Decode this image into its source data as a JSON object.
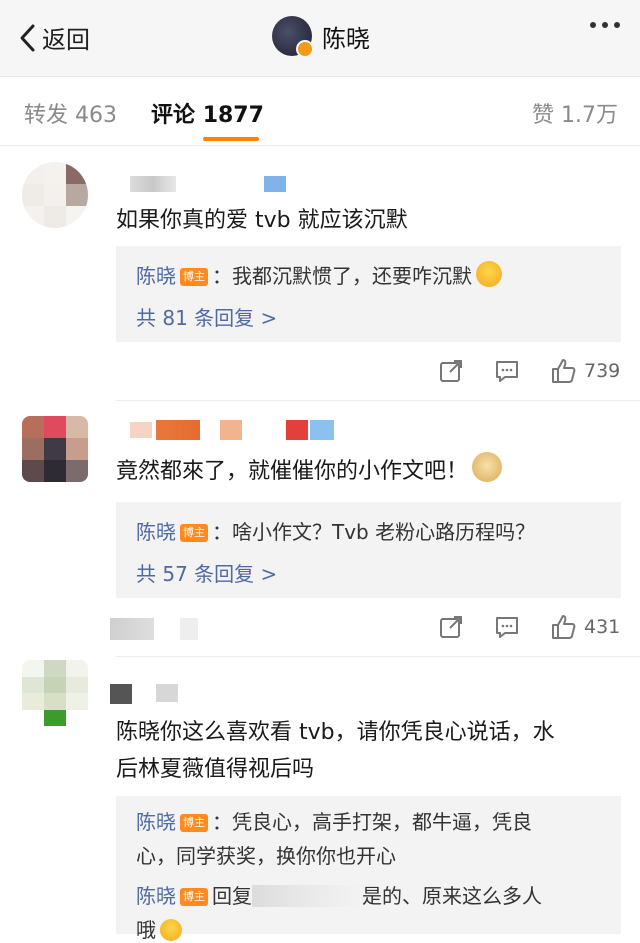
{
  "nav": {
    "back_label": "返回",
    "title": "陈晓"
  },
  "tabs": [
    {
      "label": "转发",
      "count": "463"
    },
    {
      "label": "评论",
      "count": "1877"
    },
    {
      "label": "赞",
      "count": "1.7万"
    }
  ],
  "badge_text": "博主",
  "comments": [
    {
      "text": "如果你真的爱 tvb 就应该沉默",
      "reply_author": "陈晓",
      "reply_text": "：我都沉默惯了，还要咋沉默",
      "more_replies": "共 81 条回复 >",
      "likes": "739"
    },
    {
      "text": "竟然都來了，就催催你的小作文吧！",
      "reply_author": "陈晓",
      "reply_text": "：啥小作文？Tvb 老粉心路历程吗？",
      "more_replies": "共 57 条回复 >",
      "likes": "431"
    },
    {
      "text_line1": "陈晓你这么喜欢看 tvb，请你凭良心说话，水",
      "text_line2": "后林夏薇值得视后吗",
      "reply_author": "陈晓",
      "reply_text_line1": "：凭良心，高手打架，都牛逼，凭良",
      "reply_text_line2": "心，同学获奖，换你你也开心",
      "reply2_author": "陈晓",
      "reply2_prefix": "回复",
      "reply2_text": "是的、原来这么多人",
      "reply2_text_line2": "哦"
    }
  ]
}
